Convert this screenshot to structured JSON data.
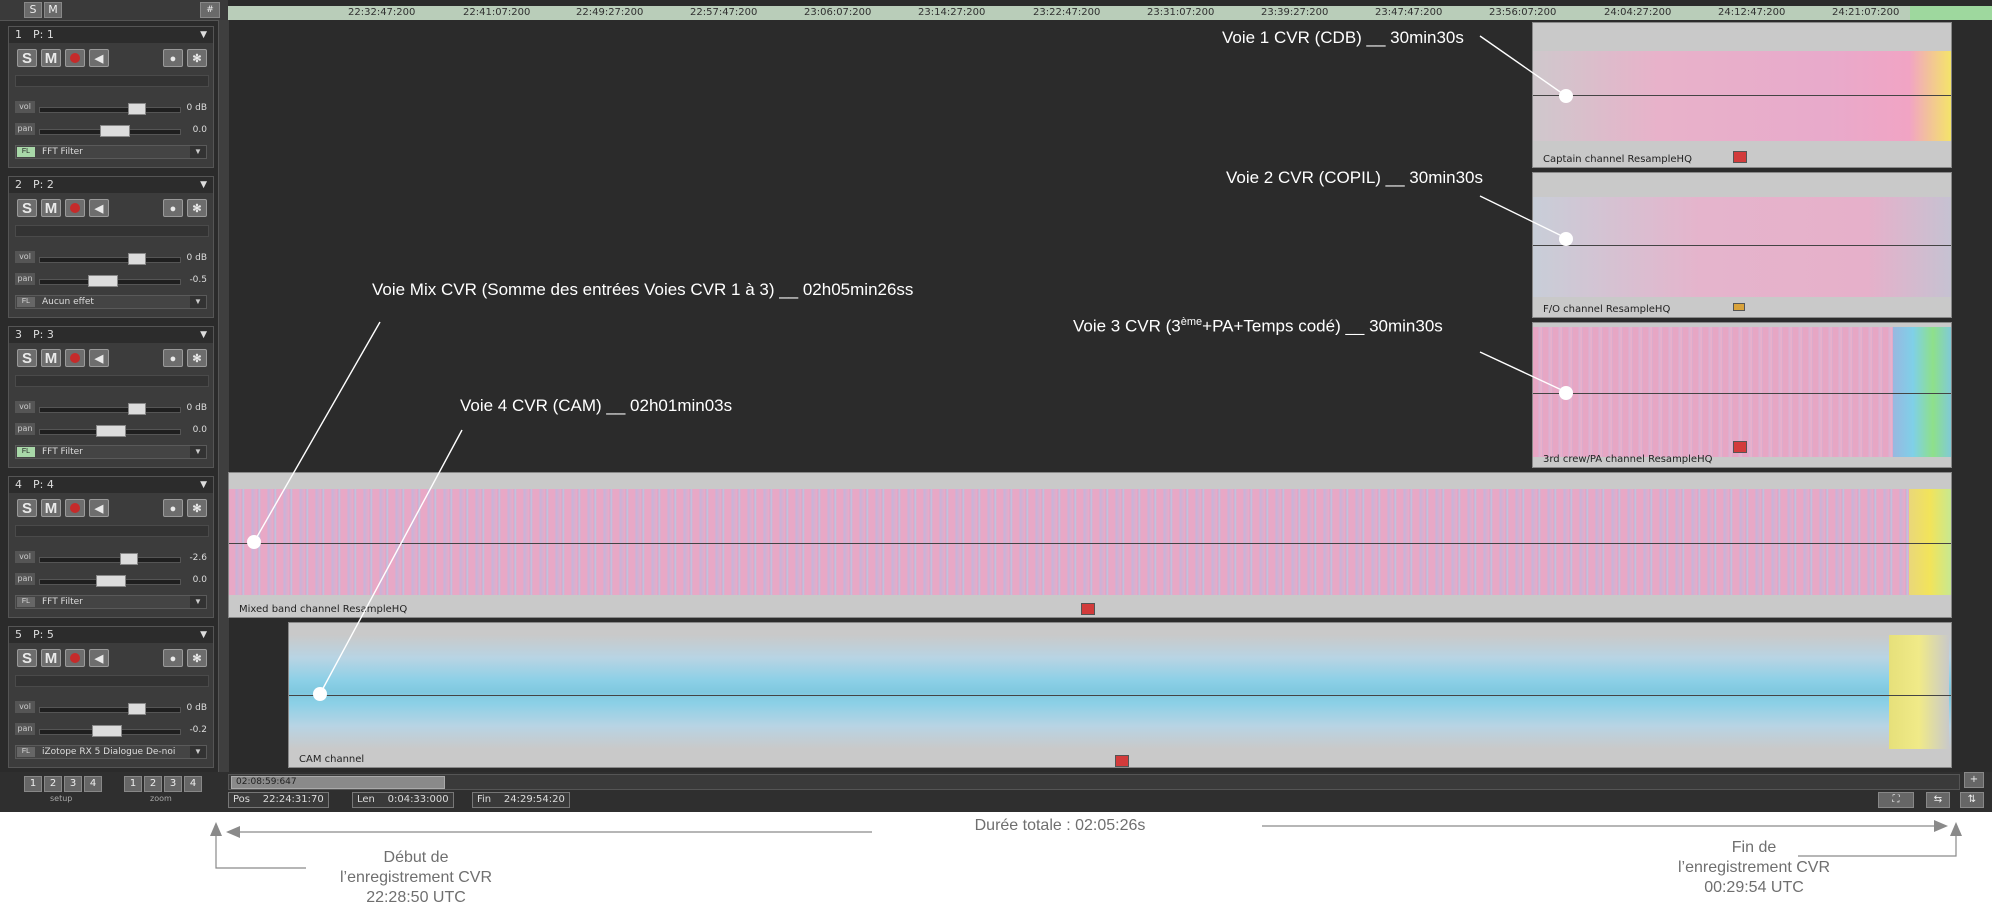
{
  "ruler": {
    "ticks": [
      "22:32:47:200",
      "22:41:07:200",
      "22:49:27:200",
      "22:57:47:200",
      "23:06:07:200",
      "23:14:27:200",
      "23:22:47:200",
      "23:31:07:200",
      "23:39:27:200",
      "23:47:47:200",
      "23:56:07:200",
      "24:04:27:200",
      "24:12:47:200",
      "24:21:07:200"
    ]
  },
  "tracks": [
    {
      "num": "1",
      "name": "P: 1",
      "vol": "0 dB",
      "pan": "0.0",
      "fx_tag": "FL",
      "fx": "FFT Filter",
      "vol_label": "vol",
      "pan_label": "pan"
    },
    {
      "num": "2",
      "name": "P: 2",
      "vol": "0 dB",
      "pan": "-0.5",
      "fx_tag": "FL",
      "fx": "Aucun effet",
      "vol_label": "vol",
      "pan_label": "pan"
    },
    {
      "num": "3",
      "name": "P: 3",
      "vol": "0 dB",
      "pan": "0.0",
      "fx_tag": "FL",
      "fx": "FFT Filter",
      "vol_label": "vol",
      "pan_label": "pan"
    },
    {
      "num": "4",
      "name": "P: 4",
      "vol": "-2.6",
      "pan": "0.0",
      "fx_tag": "FL",
      "fx": "FFT Filter",
      "vol_label": "vol",
      "pan_label": "pan"
    },
    {
      "num": "5",
      "name": "P: 5",
      "vol": "0 dB",
      "pan": "-0.2",
      "fx_tag": "FL",
      "fx": "iZotope RX 5 Dialogue De-noi",
      "vol_label": "vol",
      "pan_label": "pan"
    }
  ],
  "track_buttons": {
    "solo": "S",
    "mute": "M"
  },
  "clips": [
    {
      "label": "Captain channel  ResampleHQ"
    },
    {
      "label": "F/O channel  ResampleHQ"
    },
    {
      "label": "3rd crew/PA  channel  ResampleHQ"
    },
    {
      "label": "Mixed band channel  ResampleHQ"
    },
    {
      "label": "CAM channel"
    }
  ],
  "annotations": {
    "voie1": "Voie 1 CVR (CDB) __ 30min30s",
    "voie2": "Voie 2 CVR (COPIL) __ 30min30s",
    "voie3_pre": "Voie 3 CVR (3",
    "voie3_sup": "ème",
    "voie3_post": "+PA+Temps codé) __ 30min30s",
    "voie_mix": "Voie Mix CVR (Somme des entrées Voies CVR 1 à 3) __ 02h05min26ss",
    "voie4": "Voie 4 CVR (CAM) __ 02h01min03s"
  },
  "footer": {
    "setup_buttons": [
      "1",
      "2",
      "3",
      "4"
    ],
    "zoom_buttons": [
      "1",
      "2",
      "3",
      "4"
    ],
    "setup_label": "setup",
    "zoom_label": "zoom",
    "timecode": "02:08:59:647",
    "pos_label": "Pos",
    "pos_value": "22:24:31:70",
    "len_label": "Len",
    "len_value": "0:04:33:000",
    "fin_label": "Fin",
    "fin_value": "24:29:54:20"
  },
  "captions": {
    "duration": "Durée totale : 02:05:26s",
    "start_line1": "Début de",
    "start_line2": "l’enregistrement CVR",
    "start_line3": "22:28:50 UTC",
    "end_line1": "Fin de",
    "end_line2": "l’enregistrement CVR",
    "end_line3": "00:29:54 UTC"
  },
  "colors": {
    "daw_bg": "#2b2b2b",
    "clip_bg": "#c9c9c9",
    "wave_pink": "#e7a6c4",
    "wave_cyan": "#7fc8df",
    "annotation_text": "#ffffff",
    "caption_text": "#6f6f6f"
  }
}
